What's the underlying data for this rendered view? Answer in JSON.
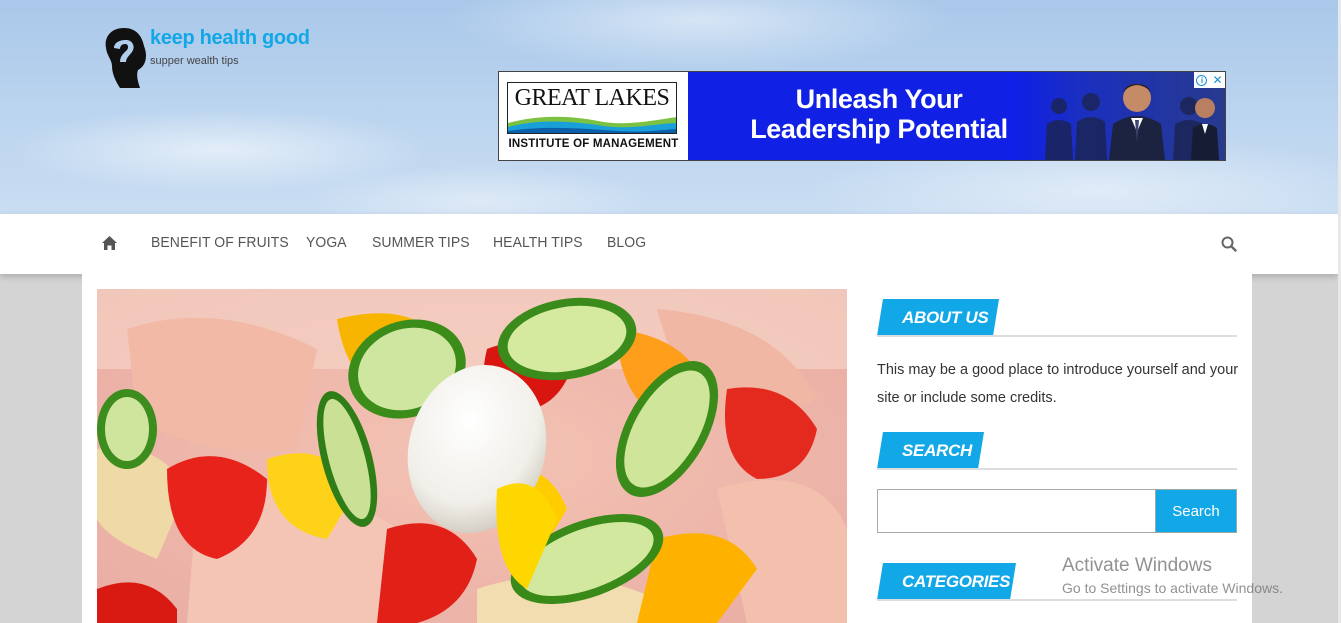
{
  "site": {
    "title": "keep health good",
    "tagline": "supper wealth tips"
  },
  "ad": {
    "brand": "GREAT LAKES",
    "brand_sub": "INSTITUTE OF MANAGEMENT",
    "headline": "Unleash Your Leadership Potential",
    "badge_icons": [
      "info-icon",
      "close-icon"
    ]
  },
  "nav": {
    "home_icon": "home-icon",
    "items": [
      {
        "label": "BENEFIT OF FRUITS"
      },
      {
        "label": "YOGA"
      },
      {
        "label": "SUMMER TIPS"
      },
      {
        "label": "HEALTH TIPS"
      },
      {
        "label": "BLOG"
      }
    ],
    "search_icon": "search-icon"
  },
  "sidebar": {
    "about": {
      "title": "ABOUT US",
      "text": "This may be a good place to introduce yourself and your site or include some credits."
    },
    "search": {
      "title": "SEARCH",
      "placeholder": "",
      "value": "",
      "button_label": "Search"
    },
    "categories": {
      "title": "CATEGORIES"
    }
  },
  "system": {
    "watermark_line1": "Activate Windows",
    "watermark_line2": "Go to Settings to activate Windows."
  },
  "colors": {
    "accent": "#12a7e6",
    "ad_blue": "#1020e4"
  }
}
